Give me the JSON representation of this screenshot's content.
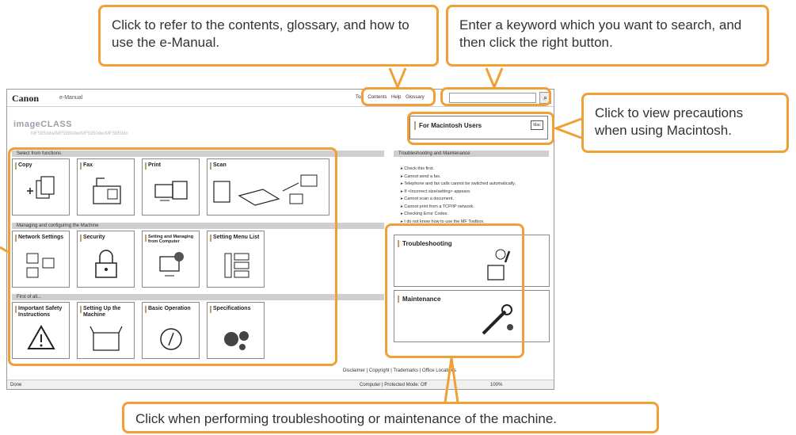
{
  "callouts": {
    "contents_help": "Click to refer to the contents, glossary, and how to use the e-Manual.",
    "search": "Enter a keyword which you want to search, and then click the right button.",
    "macintosh": "Click to view precautions when using Macintosh.",
    "troubleshooting": "Click when performing troubleshooting or maintenance of the machine."
  },
  "browser": {
    "brand": "Canon",
    "product": "e-Manual",
    "links": [
      "Top",
      "Contents",
      "Help",
      "Glossary"
    ],
    "search_icon": "magnifier-icon",
    "model_name": "imageCLASS",
    "model_sub": "MF5950dw/MF5980dw/MF5950dw/MF5950dn",
    "mac_button": "For Macintosh Users",
    "mac_icon": "Mac"
  },
  "sections": {
    "functions": "Select from functions",
    "managing": "Managing and configuring the Machine",
    "first": "First of all...",
    "troubleshooting_header": "Troubleshooting and Maintenance"
  },
  "tiles": {
    "copy": "Copy",
    "fax": "Fax",
    "print": "Print",
    "scan": "Scan",
    "network": "Network Settings",
    "security": "Security",
    "setting_managing": "Setting and Managing from Computer",
    "setting_menu": "Setting Menu List",
    "safety": "Important Safety Instructions",
    "setting_up": "Setting Up the Machine",
    "basic": "Basic Operation",
    "specs": "Specifications"
  },
  "troubleshooting_list": [
    "Check this first.",
    "Cannot send a fax.",
    "Telephone and fax calls cannot be switched automatically.",
    "If <Incorrect size/setting> appears.",
    "Cannot scan a document.",
    "Cannot print from a TCP/IP network.",
    "Checking Error Codes.",
    "I do not know how to use the MF Toolbox."
  ],
  "big_tiles": {
    "troubleshooting": "Troubleshooting",
    "maintenance": "Maintenance"
  },
  "footer": {
    "links": "Disclaimer  |  Copyright  |  Trademarks  |  Office Locations",
    "status": "Done",
    "zone": "Computer | Protected Mode: Off",
    "zoom": "100%"
  },
  "colors": {
    "accent": "#f0a035",
    "section_bar": "#cfcfcf"
  }
}
